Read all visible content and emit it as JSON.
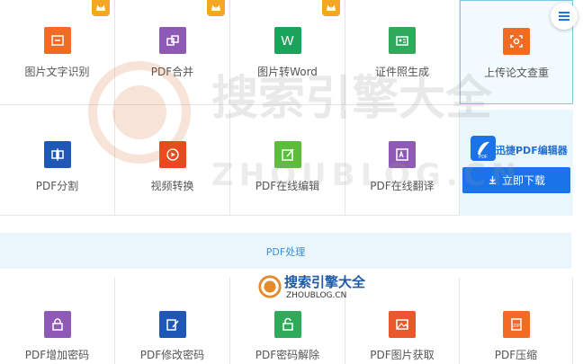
{
  "row1": [
    {
      "label": "图片文字识别",
      "icon": "image-text-icon",
      "color": "#f26b24",
      "crown": true
    },
    {
      "label": "PDF合并",
      "icon": "merge-icon",
      "color": "#8e5ab5",
      "crown": true
    },
    {
      "label": "图片转Word",
      "icon": "word-icon",
      "color": "#1aa35a",
      "crown": true,
      "glyph": "W"
    },
    {
      "label": "证件照生成",
      "icon": "id-photo-icon",
      "color": "#2eaa5a",
      "crown": false
    },
    {
      "label": "上传论文查重",
      "icon": "paper-check-icon",
      "color": "#f26b24",
      "crown": false
    }
  ],
  "row2": [
    {
      "label": "PDF分割",
      "icon": "split-icon",
      "color": "#1f57b7"
    },
    {
      "label": "视频转换",
      "icon": "video-convert-icon",
      "color": "#f26b24"
    },
    {
      "label": "PDF在线编辑",
      "icon": "edit-icon",
      "color": "#5cbd3d"
    },
    {
      "label": "PDF在线翻译",
      "icon": "translate-icon",
      "color": "#8e5ab5"
    }
  ],
  "promo": {
    "title": "迅捷PDF编辑器",
    "button": "立即下载"
  },
  "band": {
    "label": "PDF处理"
  },
  "row3": [
    {
      "label": "PDF增加密码",
      "icon": "lock-icon",
      "color": "#8e5ab5"
    },
    {
      "label": "PDF修改密码",
      "icon": "edit-lock-icon",
      "color": "#1f57b7"
    },
    {
      "label": "PDF密码解除",
      "icon": "unlock-icon",
      "color": "#2eaa5a"
    },
    {
      "label": "PDF图片获取",
      "icon": "image-icon",
      "color": "#e8582a"
    },
    {
      "label": "PDF压缩",
      "icon": "zip-icon",
      "color": "#f26b24"
    }
  ],
  "watermark": {
    "big": "搜索引擎大全",
    "url": "ZHOUBLOG.CN",
    "small": "搜索引擎大全",
    "small_url": "ZHOUBLOG.CN"
  }
}
